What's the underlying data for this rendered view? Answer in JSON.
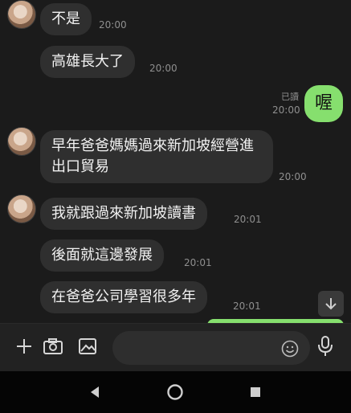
{
  "messages": [
    {
      "text": "不是",
      "time": "20:00"
    },
    {
      "text": "高雄長大了",
      "time": "20:00"
    },
    {
      "text": "喔",
      "read": "已讀",
      "time": "20:00"
    },
    {
      "text": "早年爸爸媽媽過來新加坡經營進出口貿易",
      "time": "20:00"
    },
    {
      "text": "我就跟過來新加坡讀書",
      "time": "20:01"
    },
    {
      "text": "後面就這邊發展",
      "time": "20:01"
    },
    {
      "text": "在爸爸公司學習很多年",
      "time": "20:01"
    }
  ],
  "input": {
    "placeholder": ""
  },
  "icons": {
    "add": "plus-icon",
    "camera": "camera-icon",
    "gallery": "image-icon",
    "emoji": "emoji-icon",
    "mic": "microphone-icon",
    "scroll": "arrow-down-icon",
    "back": "back-icon",
    "home": "home-icon",
    "recents": "recents-icon"
  },
  "colors": {
    "sent_bubble": "#86df6e",
    "received_bubble": "#2f2f2f",
    "background": "#1b1b1b"
  }
}
